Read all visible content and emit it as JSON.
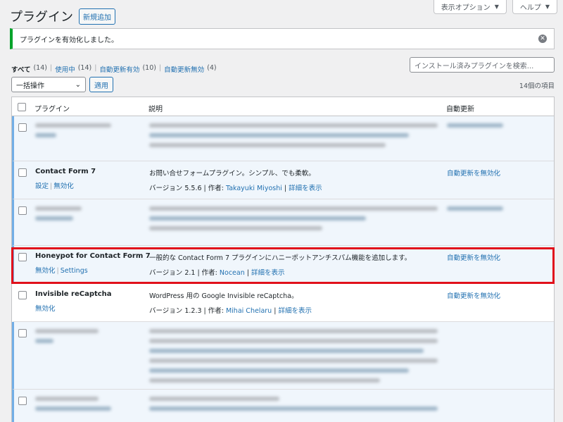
{
  "header": {
    "title": "プラグイン",
    "add_new": "新規追加",
    "screen_options": "表示オプション",
    "help": "ヘルプ"
  },
  "notice": {
    "message": "プラグインを有効化しました。"
  },
  "filters": {
    "all": "すべて",
    "all_count": "(14)",
    "active": "使用中",
    "active_count": "(14)",
    "auto_enabled": "自動更新有効",
    "auto_enabled_count": "(10)",
    "auto_disabled": "自動更新無効",
    "auto_disabled_count": "(4)"
  },
  "search": {
    "placeholder": "インストール済みプラグインを検索..."
  },
  "bulk": {
    "selected": "一括操作",
    "apply": "適用"
  },
  "item_count": "14個の項目",
  "table": {
    "col_plugin": "プラグイン",
    "col_desc": "説明",
    "col_auto": "自動更新"
  },
  "plugins": {
    "cf7": {
      "name": "Contact Form 7",
      "action1": "設定",
      "action2": "無効化",
      "desc": "お問い合せフォームプラグイン。シンプル、でも柔軟。",
      "version": "バージョン 5.5.6 | 作者: ",
      "author": "Takayuki Miyoshi",
      "details": "詳細を表示",
      "auto": "自動更新を無効化"
    },
    "honeypot": {
      "name": "Honeypot for Contact Form 7",
      "action1": "無効化",
      "action2": "Settings",
      "desc": "一般的な Contact Form 7 プラグインにハニーポットアンチスパム機能を追加します。",
      "version": "バージョン 2.1 | 作者: ",
      "author": "Nocean",
      "details": "詳細を表示",
      "auto": "自動更新を無効化"
    },
    "recaptcha": {
      "name": "Invisible reCaptcha",
      "action1": "無効化",
      "desc": "WordPress 用の Google Invisible reCaptcha。",
      "version": "バージョン 1.2.3 | 作者: ",
      "author": "Mihai Chelaru",
      "details": "詳細を表示",
      "auto": "自動更新を無効化"
    }
  },
  "colors": {
    "accent": "#2271b1",
    "highlight": "#e1111b",
    "notice": "#00a32a"
  }
}
